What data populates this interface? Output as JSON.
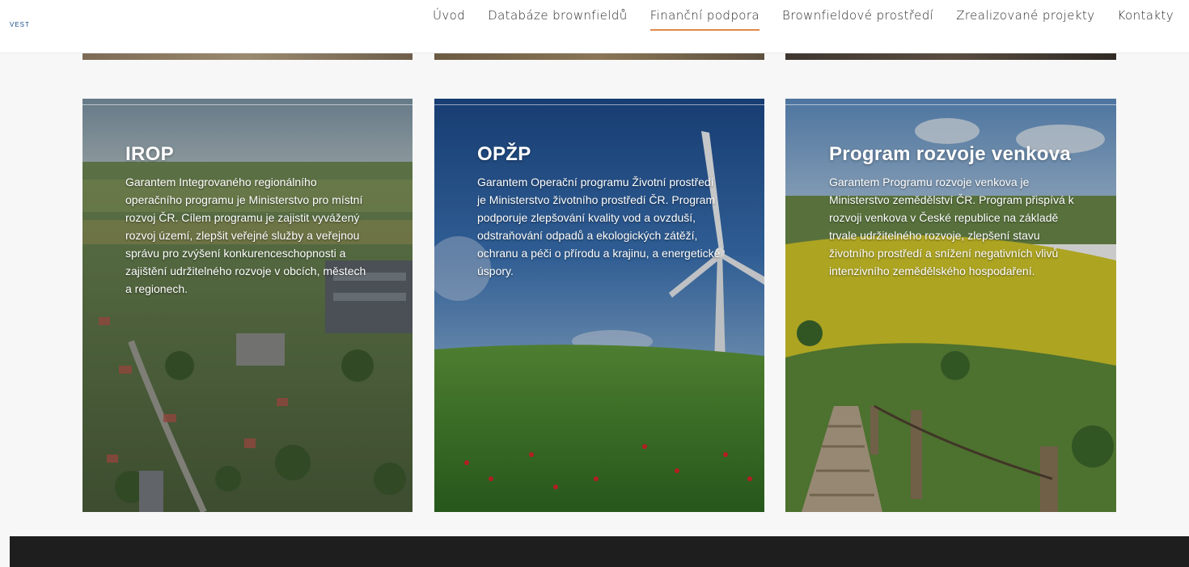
{
  "header": {
    "logo_text": "VEST",
    "nav": [
      {
        "label": "Úvod"
      },
      {
        "label": "Databáze brownfieldů"
      },
      {
        "label": "Finanční podpora"
      },
      {
        "label": "Brownfieldové prostředí"
      },
      {
        "label": "Zrealizované projekty"
      },
      {
        "label": "Kontakty"
      }
    ],
    "active_index": 2,
    "active_color": "#e0894a"
  },
  "cards": [
    {
      "title": "IROP",
      "text": "Garantem Integrovaného regionálního operačního programu je Ministerstvo pro místní rozvoj ČR. Cílem programu je zajistit vyvážený rozvoj území, zlepšit veřejné služby a veřejnou správu pro zvýšení konkurenceschopnosti a zajištění udržitelného rozvoje v obcích, městech a regionech."
    },
    {
      "title": "OPŽP",
      "text": "Garantem Operační programu Životní prostředí je Ministerstvo životního prostředí ČR. Program podporuje zlepšování kvality vod a ovzduší, odstraňování odpadů a ekologických zátěží, ochranu a péči o přírodu a krajinu, a energetické úspory."
    },
    {
      "title": "Program rozvoje venkova",
      "text": "Garantem Programu rozvoje venkova je Ministerstvo zemědělství ČR. Program přispívá k rozvoji venkova v České republice na základě trvale udržitelného rozvoje, zlepšení stavu životního prostředí a snížení negativních vlivů intenzivního zemědělského hospodaření."
    }
  ]
}
